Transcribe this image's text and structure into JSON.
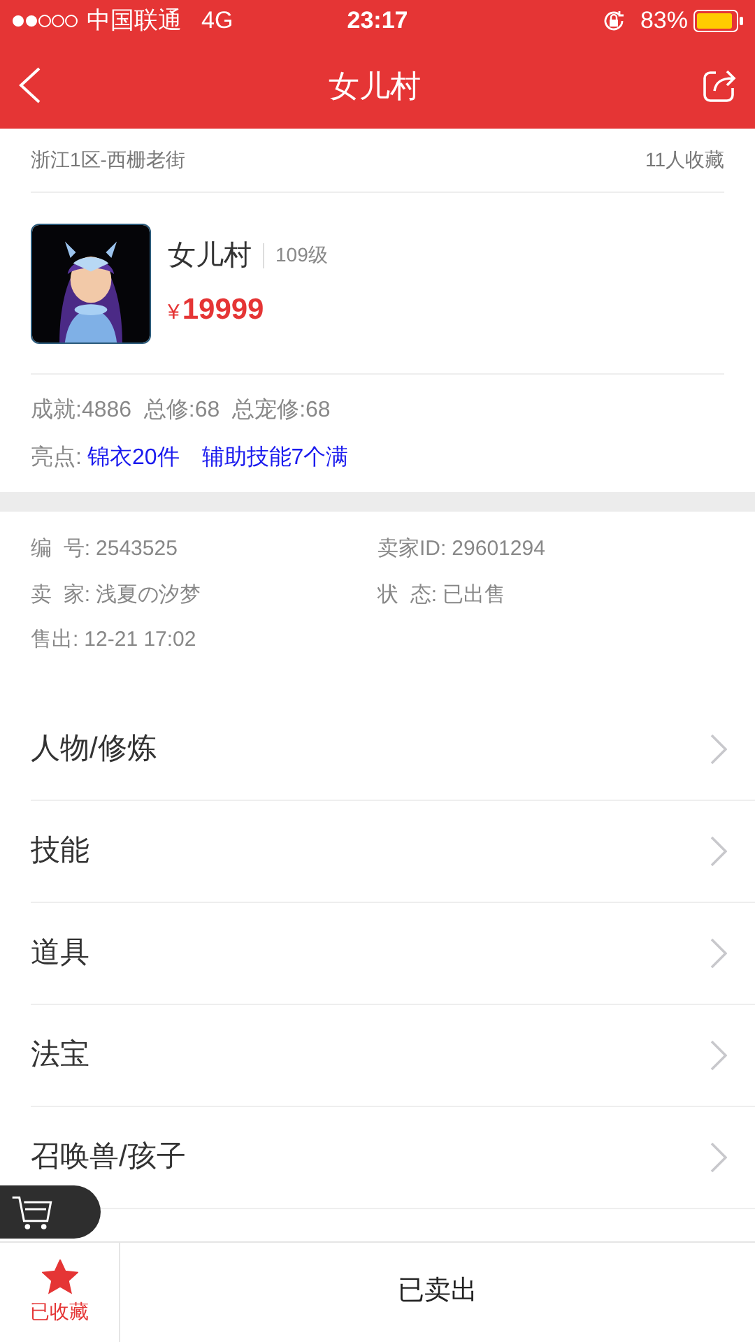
{
  "status_bar": {
    "carrier": "中国联通",
    "network": "4G",
    "time": "23:17",
    "battery": "83%"
  },
  "nav": {
    "title": "女儿村"
  },
  "location": {
    "server": "浙江1区-西栅老街",
    "favorites": "11人收藏"
  },
  "character": {
    "name": "女儿村",
    "level": "109级",
    "price_symbol": "¥",
    "price": "19999"
  },
  "stats": "成就:4886  总修:68  总宠修:68",
  "highlights": {
    "label": "亮点:",
    "tags": [
      "锦衣20件",
      "辅助技能7个满"
    ]
  },
  "info": [
    {
      "label": "编  号:",
      "value": "2543525"
    },
    {
      "label": "卖家ID:",
      "value": "29601294"
    },
    {
      "label": "卖  家:",
      "value": "浅夏の汐梦"
    },
    {
      "label": "状  态:",
      "value": "已出售"
    },
    {
      "label": "售出:",
      "value": "12-21 17:02"
    }
  ],
  "menu": [
    "人物/修炼",
    "技能",
    "道具",
    "法宝",
    "召唤兽/孩子"
  ],
  "bottom_bar": {
    "favorite": {
      "label": "已收藏",
      "saved": true
    },
    "action": "已卖出"
  }
}
